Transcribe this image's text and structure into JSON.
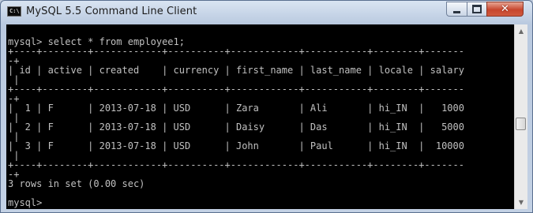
{
  "window": {
    "title": "MySQL 5.5 Command Line Client",
    "icon": "console-icon",
    "icon_text": "C:\\",
    "controls": {
      "minimize": "minimize-icon",
      "maximize": "maximize-icon",
      "close": "close-icon",
      "close_glyph": "✕"
    }
  },
  "console": {
    "lines": [
      "",
      "mysql> select * from employee1;",
      "+----+--------+------------+----------+------------+-----------+--------+-------",
      "-+",
      "| id | active | created    | currency | first_name | last_name | locale | salary",
      " |",
      "+----+--------+------------+----------+------------+-----------+--------+-------",
      "-+",
      "|  1 | F      | 2013-07-18 | USD      | Zara       | Ali       | hi_IN  |   1000",
      " |",
      "|  2 | F      | 2013-07-18 | USD      | Daisy      | Das       | hi_IN  |   5000",
      " |",
      "|  3 | F      | 2013-07-18 | USD      | John       | Paul      | hi_IN  |  10000",
      " |",
      "+----+--------+------------+----------+------------+-----------+--------+-------",
      "-+",
      "3 rows in set (0.00 sec)",
      "",
      "mysql>"
    ]
  },
  "scrollbar": {
    "up_glyph": "▲",
    "down_glyph": "▼"
  },
  "colors": {
    "console_bg": "#000000",
    "console_text": "#c0c0c0",
    "close_button": "#c7462e"
  }
}
